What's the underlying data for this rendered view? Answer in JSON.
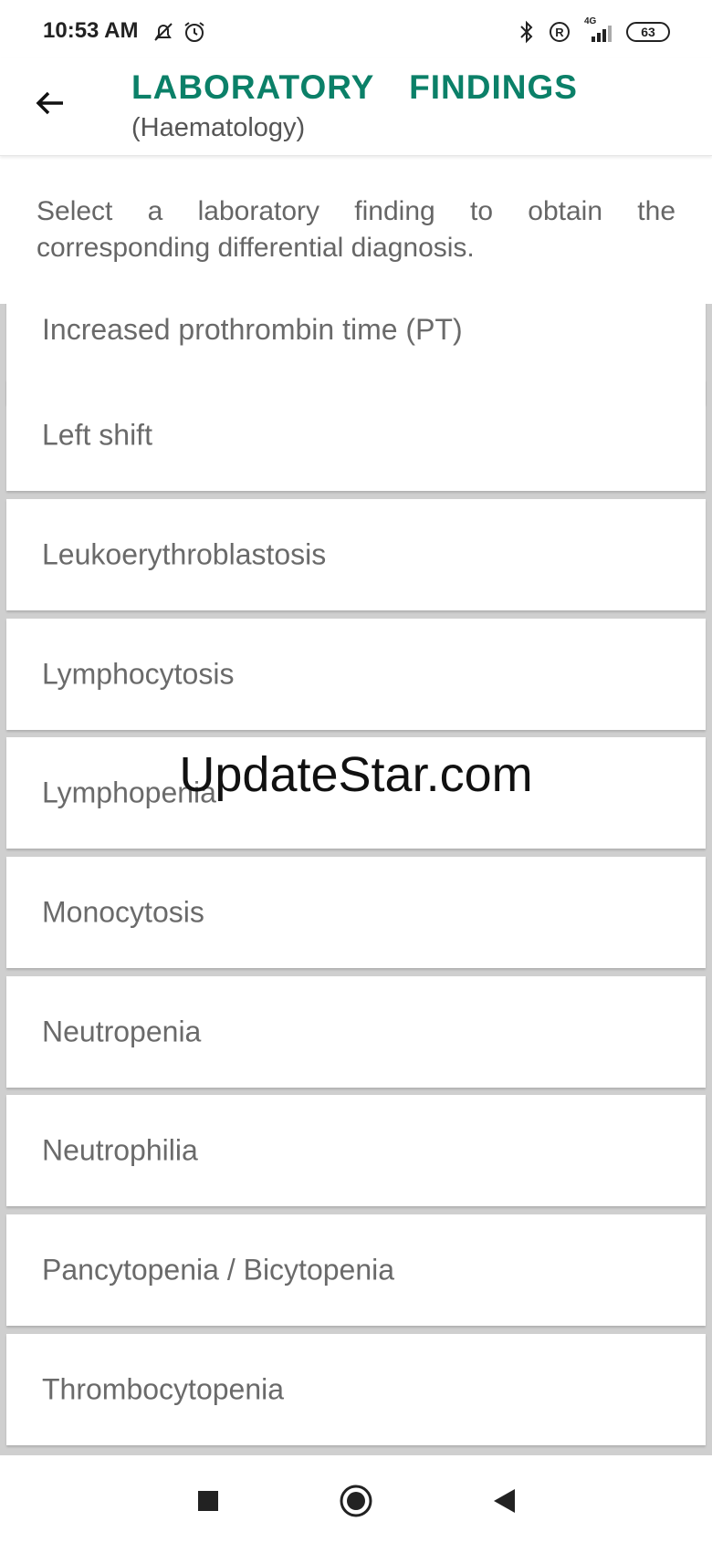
{
  "status_bar": {
    "time": "10:53 AM",
    "left_icons": [
      "muted-bell-icon",
      "alarm-clock-icon"
    ],
    "right_icons": [
      "bluetooth-icon",
      "registered-icon",
      "signal-4g-icon"
    ],
    "network_label": "4G",
    "battery": "63"
  },
  "header": {
    "title": "LABORATORY  FINDINGS",
    "subtitle": "(Haematology)",
    "accent_color": "#0b8068"
  },
  "instruction": "Select a laboratory finding to obtain the corresponding differential diagnosis.",
  "findings": [
    "Increased prothrombin time (PT)",
    "Left shift",
    "Leukoerythroblastosis",
    "Lymphocytosis",
    "Lymphopenia",
    "Monocytosis",
    "Neutropenia",
    "Neutrophilia",
    "Pancytopenia / Bicytopenia",
    "Thrombocytopenia"
  ],
  "watermark": "UpdateStar.com",
  "nav_bar": [
    "recents-square-icon",
    "home-circle-icon",
    "back-triangle-icon"
  ]
}
